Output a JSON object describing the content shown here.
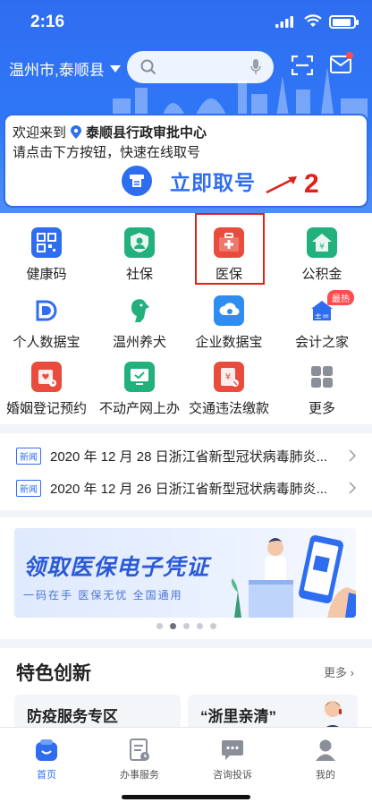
{
  "status_bar": {
    "time": "2:16"
  },
  "header": {
    "location": "温州市,泰顺县",
    "search_placeholder": ""
  },
  "ticket": {
    "welcome_prefix": "欢迎来到",
    "center_name": "泰顺县行政审批中心",
    "instruction": "请点击下方按钮，快速在线取号",
    "button_label": "立即取号",
    "annotation_number": "2"
  },
  "services": [
    {
      "label": "健康码",
      "icon": "health-code-icon",
      "color": "#2f6df0"
    },
    {
      "label": "社保",
      "icon": "social-security-icon",
      "color": "#22b07d"
    },
    {
      "label": "医保",
      "icon": "medical-kit-icon",
      "color": "#e94b3c"
    },
    {
      "label": "公积金",
      "icon": "housing-fund-icon",
      "color": "#22b07d"
    },
    {
      "label": "个人数据宝",
      "icon": "personal-data-icon",
      "color": "#2f6df0"
    },
    {
      "label": "温州养犬",
      "icon": "dog-icon",
      "color": "#22b07d"
    },
    {
      "label": "企业数据宝",
      "icon": "enterprise-data-icon",
      "color": "#2f8df0"
    },
    {
      "label": "会计之家",
      "icon": "accounting-icon",
      "color": "#2f6df0",
      "badge": "最热"
    },
    {
      "label": "婚姻登记预约",
      "icon": "marriage-calendar-icon",
      "color": "#e94b3c"
    },
    {
      "label": "不动产网上办",
      "icon": "real-estate-icon",
      "color": "#22b07d"
    },
    {
      "label": "交通违法缴款",
      "icon": "traffic-fine-icon",
      "color": "#e94b3c"
    },
    {
      "label": "更多",
      "icon": "more-grid-icon",
      "color": "#8a8f99"
    }
  ],
  "news": [
    {
      "tag": "新闻",
      "text": "2020 年 12 月 28 日浙江省新型冠状病毒肺炎..."
    },
    {
      "tag": "新闻",
      "text": "2020 年 12 月 26 日浙江省新型冠状病毒肺炎..."
    }
  ],
  "banner": {
    "title": "领取医保电子凭证",
    "subtitle": "一码在手  医保无忧  全国通用",
    "active_dot": 1,
    "dot_count": 5
  },
  "feature": {
    "title": "特色创新",
    "more_label": "更多",
    "cards": [
      {
        "title": "防疫服务专区"
      },
      {
        "title": "“浙里亲清”"
      }
    ]
  },
  "tabbar": [
    {
      "label": "首页",
      "icon": "home-icon",
      "active": true
    },
    {
      "label": "办事服务",
      "icon": "service-doc-icon",
      "active": false
    },
    {
      "label": "咨询投诉",
      "icon": "chat-icon",
      "active": false
    },
    {
      "label": "我的",
      "icon": "user-icon",
      "active": false
    }
  ],
  "colors": {
    "primary": "#2f6df0",
    "annotation": "#e0201b"
  }
}
